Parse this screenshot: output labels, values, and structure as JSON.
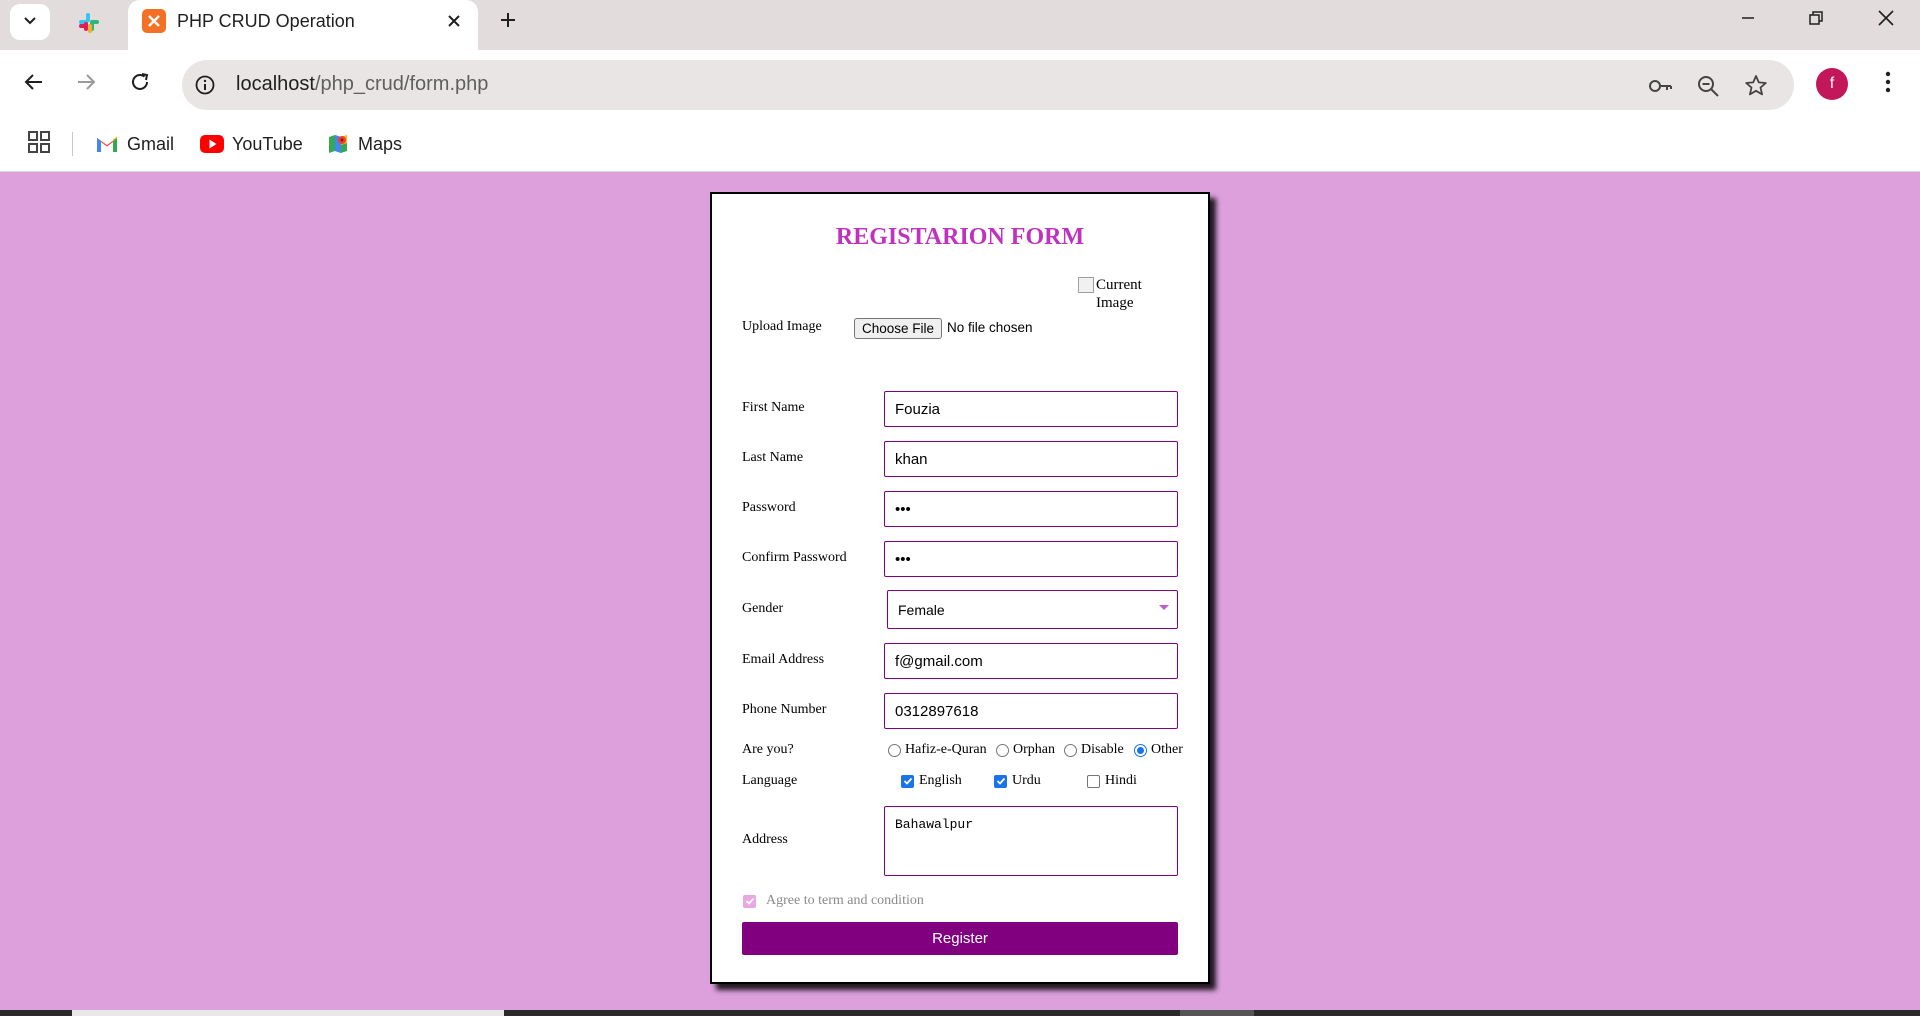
{
  "browser": {
    "tab_title": "PHP CRUD Operation",
    "url_host": "localhost",
    "url_path": "/php_crud/form.php",
    "profile_initial": "f",
    "bookmarks": [
      {
        "label": "Gmail",
        "icon": "gmail-icon"
      },
      {
        "label": "YouTube",
        "icon": "youtube-icon"
      },
      {
        "label": "Maps",
        "icon": "maps-icon"
      }
    ]
  },
  "form": {
    "title": "REGISTARION FORM",
    "upload_label": "Upload Image",
    "current_image_alt": "Current Image",
    "choose_file_label": "Choose File",
    "file_status": "No file chosen",
    "first_name": {
      "label": "First Name",
      "value": "Fouzia"
    },
    "last_name": {
      "label": "Last Name",
      "value": "khan"
    },
    "password": {
      "label": "Password",
      "value": "•••"
    },
    "confirm_password": {
      "label": "Confirm Password",
      "value": "•••"
    },
    "gender": {
      "label": "Gender",
      "value": "Female"
    },
    "email": {
      "label": "Email Address",
      "value": "f@gmail.com"
    },
    "phone": {
      "label": "Phone Number",
      "value": "0312897618"
    },
    "are_you": {
      "label": "Are you?",
      "options": [
        {
          "label": "Hafiz-e-Quran",
          "checked": false
        },
        {
          "label": "Orphan",
          "checked": false
        },
        {
          "label": "Disable",
          "checked": false
        },
        {
          "label": "Other",
          "checked": true
        }
      ]
    },
    "language": {
      "label": "Language",
      "options": [
        {
          "label": "English",
          "checked": true
        },
        {
          "label": "Urdu",
          "checked": true
        },
        {
          "label": "Hindi",
          "checked": false
        }
      ]
    },
    "address": {
      "label": "Address",
      "value": "Bahawalpur"
    },
    "agree_label": "Agree to term and condition",
    "submit_label": "Register"
  },
  "colors": {
    "page_background": "#dda0dd",
    "accent": "#800080",
    "title": "#bf32bf",
    "checkbox_checked": "#1a73e8"
  }
}
